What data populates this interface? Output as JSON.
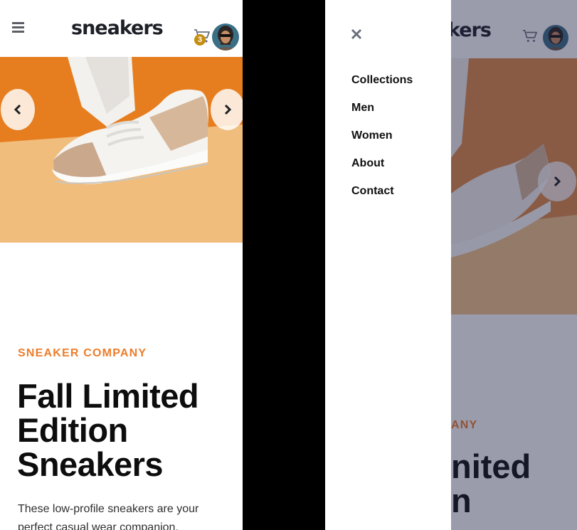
{
  "brand": {
    "logo": "sneakers"
  },
  "cart": {
    "count": "3"
  },
  "product": {
    "company": "SNEAKER COMPANY",
    "title_line1": "Fall Limited",
    "title_line2": "Edition",
    "title_line3": "Sneakers",
    "description": "These low-profile sneakers are your perfect casual wear companion."
  },
  "menu": {
    "items": [
      {
        "label": "Collections"
      },
      {
        "label": "Men"
      },
      {
        "label": "Women"
      },
      {
        "label": "About"
      },
      {
        "label": "Contact"
      }
    ]
  },
  "background_page": {
    "logo_fragment": "kers",
    "company_fragment": "ANY",
    "title_fragment_line1": "nited",
    "title_fragment_line2": "n"
  },
  "colors": {
    "accent": "#ee7d2a",
    "badge": "#c58e10",
    "overlay": "#1f2244"
  },
  "icons": [
    "menu-icon",
    "cart-icon",
    "chevron-left-icon",
    "chevron-right-icon",
    "close-icon"
  ]
}
